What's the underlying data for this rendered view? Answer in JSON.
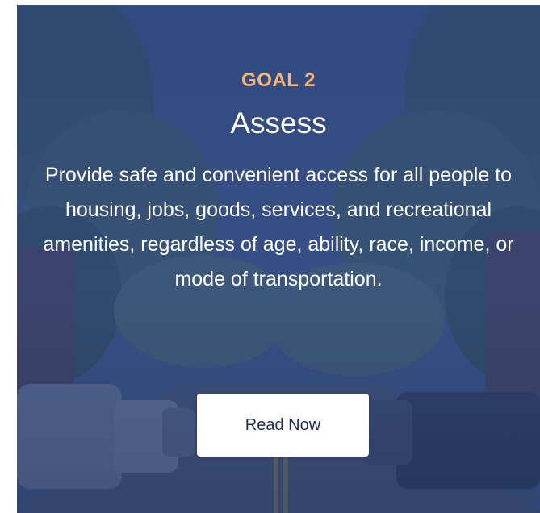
{
  "card": {
    "goal_label": "GOAL 2",
    "title": "Assess",
    "description": "Provide safe and convenient access for all people to housing, jobs, goods, services, and recreational amenities, regardless of age, ability, race, income, or mode of transportation.",
    "button_label": "Read Now"
  },
  "colors": {
    "overlay": "#2b4783",
    "goal_accent": "#f2b679",
    "button_bg": "#ffffff",
    "button_text": "#1f2e4f"
  },
  "background_image": "street-scene-with-trees-and-parked-cars"
}
